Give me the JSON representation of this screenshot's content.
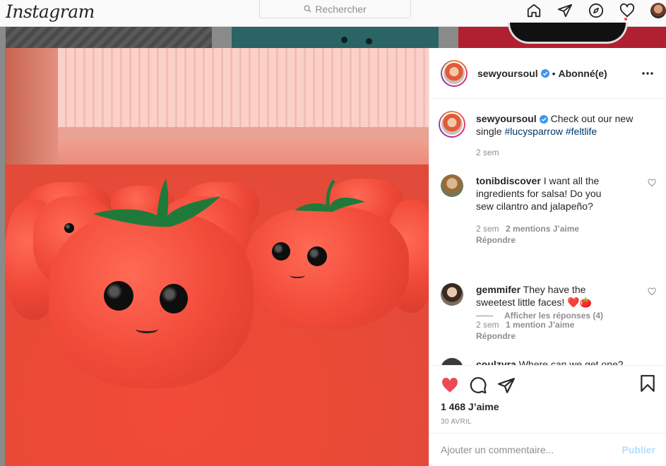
{
  "header": {
    "logo": "Instagram",
    "search_placeholder": "Rechercher",
    "icons": [
      "home-icon",
      "direct-icon",
      "explore-icon",
      "activity-heart-icon",
      "profile-avatar"
    ]
  },
  "post": {
    "author": "sewyoursoul",
    "follow_status": "Abonné(e)",
    "separator": "•",
    "caption": {
      "username": "sewyoursoul",
      "text": "Check out our new single",
      "hashtag_1": "#lucysparrow",
      "hashtag_2": "#feltlife",
      "time": "2 sem"
    },
    "comments": [
      {
        "username": "tonibdiscover",
        "text": "I want all the ingredients for salsa! Do you sew cilantro and jalapeño?",
        "time": "2 sem",
        "likes": "2 mentions J’aime",
        "reply": "Répondre"
      },
      {
        "username": "gemmifer",
        "text": "They have the sweetest little faces! ❤️🍅",
        "time": "2 sem",
        "likes": "1 mention J’aime",
        "reply": "Répondre"
      },
      {
        "username": "coulzyra",
        "text": "Where can we get one?"
      }
    ],
    "view_replies": "Afficher les réponses (4)",
    "likes_count": "1 468 J’aime",
    "date": "30 AVRIL",
    "add_comment_placeholder": "Ajouter un commentaire...",
    "publish_label": "Publier"
  },
  "colors": {
    "like_red": "#ed4956",
    "link_blue": "#00376b",
    "verified_blue": "#3897f0",
    "publish_disabled": "#b2dffc"
  }
}
